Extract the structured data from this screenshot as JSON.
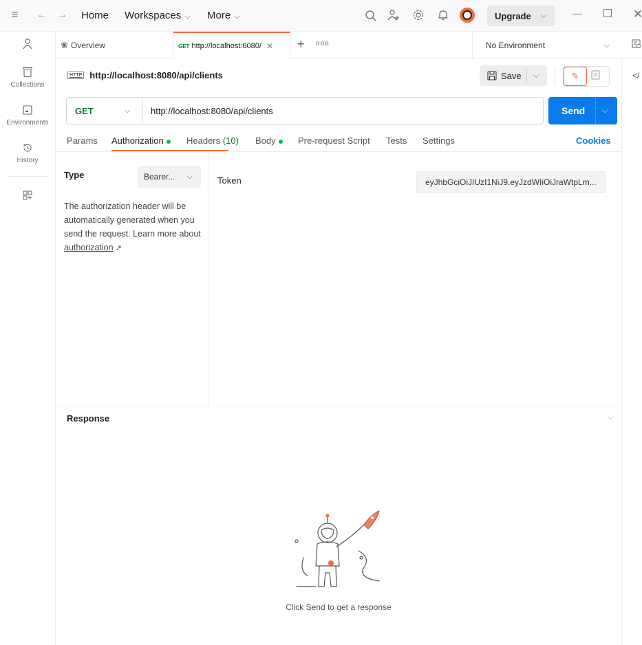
{
  "titlebar": {
    "nav_home": "Home",
    "nav_workspaces": "Workspaces",
    "nav_more": "More",
    "upgrade_label": "Upgrade"
  },
  "sidebar": {
    "items": [
      {
        "label": "Collections",
        "icon": "collections-icon"
      },
      {
        "label": "Environments",
        "icon": "environments-icon"
      },
      {
        "label": "History",
        "icon": "history-icon"
      }
    ]
  },
  "tabs": {
    "overview_label": "Overview",
    "active_method": "GET",
    "active_url": "http://localhost:8080/"
  },
  "environment": {
    "selected": "No Environment"
  },
  "request": {
    "title": "http://localhost:8080/api/clients",
    "http_badge": "HTTP",
    "save_label": "Save",
    "method": "GET",
    "url": "http://localhost:8080/api/clients",
    "send_label": "Send"
  },
  "subtabs": {
    "params": "Params",
    "authorization": "Authorization",
    "headers": "Headers",
    "headers_count": "(10)",
    "body": "Body",
    "prerequest": "Pre-request Script",
    "tests": "Tests",
    "settings": "Settings",
    "cookies": "Cookies"
  },
  "auth": {
    "type_label": "Type",
    "type_value": "Bearer...",
    "description_pre": "The authorization header will be automatically generated when you send the request. Learn more about ",
    "description_link": "authorization",
    "token_label": "Token",
    "token_value": "eyJhbGciOiJIUzI1NiJ9.eyJzdWIiOiJraWtpLm..."
  },
  "response": {
    "title": "Response",
    "empty_message": "Click Send to get a response"
  },
  "colors": {
    "accent": "#f26b3a",
    "send_blue": "#097bed",
    "method_green": "#0a7a2e",
    "dot_green": "#0cbb52"
  }
}
